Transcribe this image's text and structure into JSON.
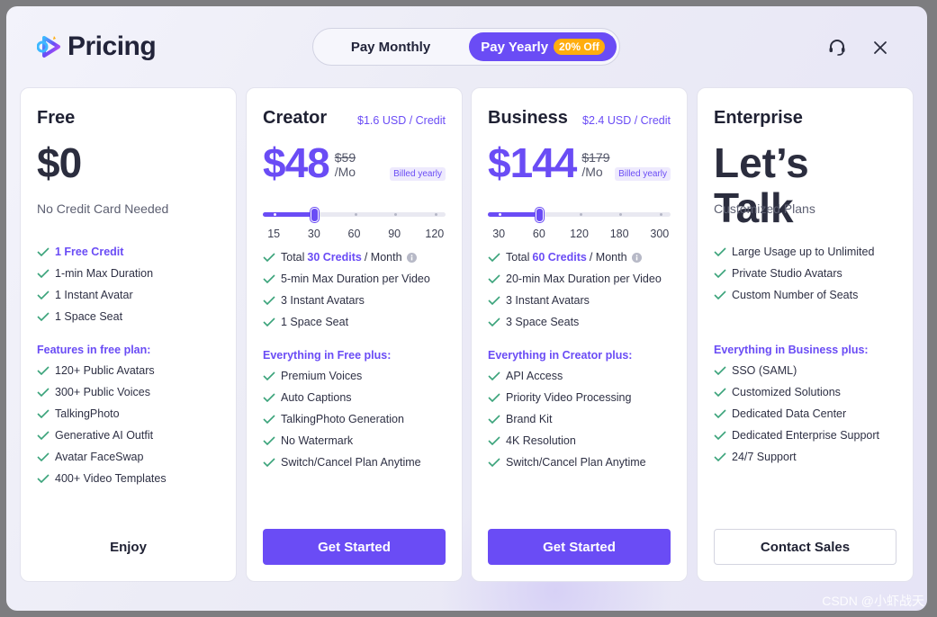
{
  "header": {
    "title": "Pricing",
    "toggle": {
      "monthly_label": "Pay Monthly",
      "yearly_label": "Pay Yearly",
      "yearly_badge": "20% Off",
      "selected": "yearly"
    }
  },
  "colors": {
    "accent": "#6a4cf5",
    "badge": "#ffad0e",
    "check": "#3aa37a"
  },
  "plans": [
    {
      "name": "Free",
      "price": "$0",
      "subtitle": "No Credit Card Needed",
      "features": [
        {
          "text": "1 Free Credit"
        },
        {
          "text": "1-min Max Duration"
        },
        {
          "text": "1 Instant Avatar"
        },
        {
          "text": "1 Space Seat"
        }
      ],
      "group_title": "Features in free plan:",
      "group_features": [
        "120+ Public Avatars",
        "300+ Public Voices",
        "TalkingPhoto",
        "Generative AI Outfit",
        "Avatar FaceSwap",
        "400+ Video Templates"
      ],
      "cta": "Enjoy"
    },
    {
      "name": "Creator",
      "credit_rate": "$1.6 USD / Credit",
      "price": "$48",
      "original_price": "$59",
      "unit": "/Mo",
      "billed": "Billed yearly",
      "slider": {
        "ticks": [
          "15",
          "30",
          "60",
          "90",
          "120"
        ],
        "selected": "30"
      },
      "credits_prefix": "Total",
      "credits_value": "30 Credits",
      "credits_suffix": "/ Month",
      "features": [
        "5-min Max Duration per Video",
        "3 Instant Avatars",
        "1 Space Seat"
      ],
      "group_title": "Everything in Free plus:",
      "group_features": [
        "Premium Voices",
        "Auto Captions",
        "TalkingPhoto Generation",
        "No Watermark",
        "Switch/Cancel Plan Anytime"
      ],
      "cta": "Get Started"
    },
    {
      "name": "Business",
      "credit_rate": "$2.4 USD / Credit",
      "price": "$144",
      "original_price": "$179",
      "unit": "/Mo",
      "billed": "Billed yearly",
      "slider": {
        "ticks": [
          "30",
          "60",
          "120",
          "180",
          "300"
        ],
        "selected": "60"
      },
      "credits_prefix": "Total",
      "credits_value": "60 Credits",
      "credits_suffix": "/ Month",
      "features": [
        "20-min Max Duration per Video",
        "3 Instant Avatars",
        "3 Space Seats"
      ],
      "group_title": "Everything in Creator plus:",
      "group_features": [
        "API Access",
        "Priority Video Processing",
        "Brand Kit",
        "4K Resolution",
        "Switch/Cancel Plan Anytime"
      ],
      "cta": "Get Started"
    },
    {
      "name": "Enterprise",
      "price": "Let’s Talk",
      "subtitle": "Customized Plans",
      "features": [
        "Large Usage up to Unlimited",
        "Private Studio Avatars",
        "Custom Number of Seats"
      ],
      "group_title": "Everything in Business plus:",
      "group_features": [
        "SSO (SAML)",
        "Customized Solutions",
        "Dedicated Data Center",
        "Dedicated Enterprise Support",
        "24/7 Support"
      ],
      "cta": "Contact Sales"
    }
  ],
  "watermark": "CSDN @小虾战天"
}
